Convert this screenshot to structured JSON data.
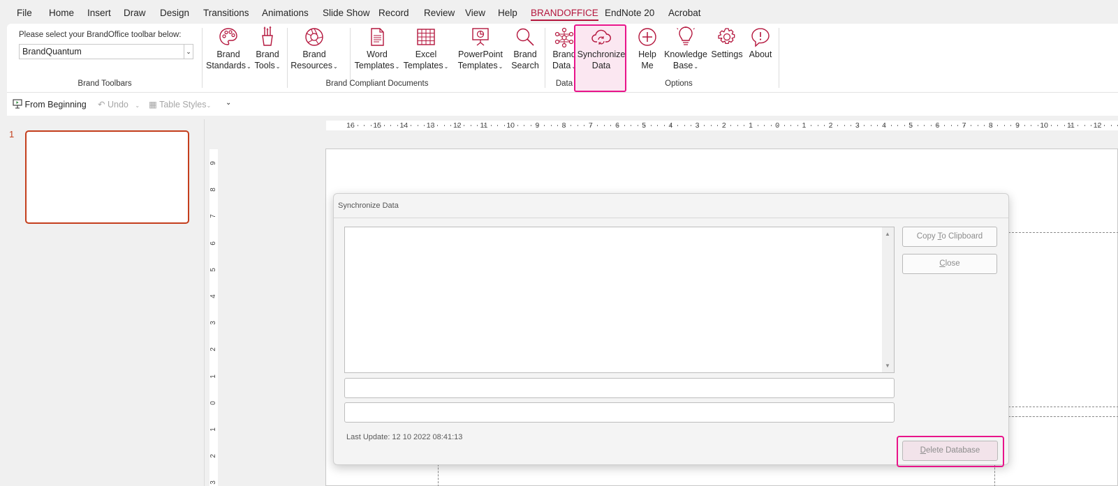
{
  "menu": {
    "tabs": [
      "File",
      "Home",
      "Insert",
      "Draw",
      "Design",
      "Transitions",
      "Animations",
      "Slide Show",
      "Record",
      "Review",
      "View",
      "Help",
      "BRANDOFFICE",
      "EndNote 20",
      "Acrobat"
    ],
    "active": "BRANDOFFICE"
  },
  "ribbon": {
    "select_label": "Please select your BrandOffice toolbar below:",
    "select_value": "BrandQuantum",
    "groups": {
      "brand_toolbars": "Brand Toolbars",
      "brand_compliant": "Brand Compliant Documents",
      "data": "Data",
      "options": "Options"
    },
    "buttons": {
      "brand_standards": [
        "Brand",
        "Standards"
      ],
      "brand_tools": [
        "Brand",
        "Tools"
      ],
      "brand_resources": [
        "Brand",
        "Resources"
      ],
      "word_templates": [
        "Word",
        "Templates"
      ],
      "excel_templates": [
        "Excel",
        "Templates"
      ],
      "powerpoint_templates": [
        "PowerPoint",
        "Templates"
      ],
      "brand_search": [
        "Brand",
        "Search"
      ],
      "brand_data": [
        "Brand",
        "Data"
      ],
      "synchronize_data": [
        "Synchronize",
        "Data"
      ],
      "help_me": [
        "Help",
        "Me"
      ],
      "knowledge_base": [
        "Knowledge",
        "Base"
      ],
      "settings": "Settings",
      "about": "About"
    },
    "accent_color": "#b4163d",
    "highlight_color": "#e8148a"
  },
  "quick_access": {
    "from_beginning": "From Beginning",
    "undo": "Undo",
    "table_styles": "Table Styles"
  },
  "slides_panel": {
    "slide_number": "1"
  },
  "rulers": {
    "horizontal": [
      "16",
      "15",
      "14",
      "13",
      "12",
      "11",
      "10",
      "9",
      "8",
      "7",
      "6",
      "5",
      "4",
      "3",
      "2",
      "1",
      "0",
      "1",
      "2",
      "3",
      "4",
      "5",
      "6",
      "7",
      "8",
      "9",
      "10",
      "11",
      "12"
    ],
    "vertical": [
      "9",
      "8",
      "7",
      "6",
      "5",
      "4",
      "3",
      "2",
      "1",
      "0",
      "1",
      "2",
      "3"
    ]
  },
  "dialog": {
    "title": "Synchronize Data",
    "copy_button": {
      "pre": "Copy ",
      "key": "T",
      "post": "o Clipboard"
    },
    "close_button": {
      "pre": "",
      "key": "C",
      "post": "lose"
    },
    "delete_button": {
      "pre": "",
      "key": "D",
      "post": "elete Database"
    },
    "last_update": "Last Update: 12 10 2022 08:41:13"
  }
}
